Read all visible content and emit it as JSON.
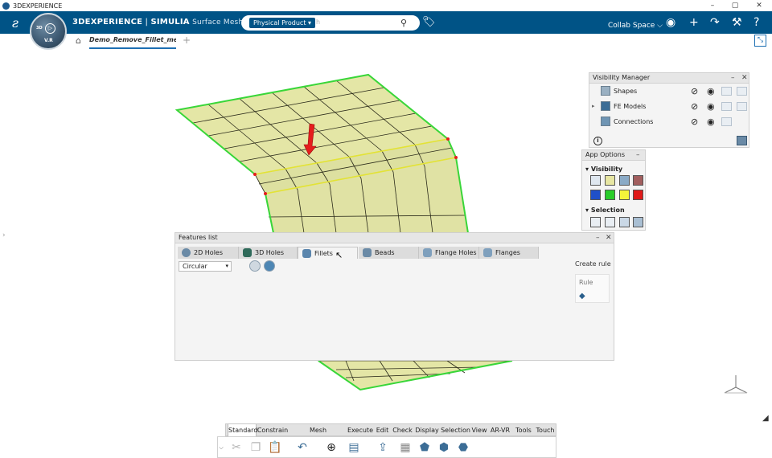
{
  "window": {
    "title": "3DEXPERIENCE",
    "controls": [
      "–",
      "▢",
      "✕"
    ]
  },
  "app": {
    "brand": "3DEXPERIENCE",
    "separator": " | ",
    "product": "SIMULIA",
    "app_name": "Surface Mesher",
    "compass_version": "V.R",
    "compass_top": "3D",
    "compass_right": "▷"
  },
  "search": {
    "scope": "Physical Product ▾",
    "placeholder": "h"
  },
  "header": {
    "collab_space": "Collab Space ⌵"
  },
  "tabs": {
    "doc_title": "Demo_Remove_Fillet_meshi",
    "add": "+"
  },
  "visibility_manager": {
    "title": "Visibility Manager",
    "rows": [
      {
        "label": "Shapes"
      },
      {
        "label": "FE Models"
      },
      {
        "label": "Connections"
      }
    ],
    "info": "i"
  },
  "app_options": {
    "title": "App Options",
    "visibility_label": "Visibility",
    "selection_label": "Selection",
    "swatches": [
      "#2050c8",
      "#29cc29",
      "#f3f33a",
      "#e01a1a"
    ]
  },
  "features_list": {
    "title": "Features list",
    "tabs": [
      {
        "label": "2D Holes"
      },
      {
        "label": "3D Holes"
      },
      {
        "label": "Fillets"
      },
      {
        "label": "Beads"
      },
      {
        "label": "Flange Holes"
      },
      {
        "label": "Flanges"
      }
    ],
    "dropdown_value": "Circular",
    "create_rule": "Create rule",
    "rule": "Rule"
  },
  "action_bar": {
    "tabs": [
      "Standard",
      "Constrain",
      "Mesh Specifications",
      "Execute",
      "Edit",
      "Check",
      "Display",
      "Selection",
      "View",
      "AR-VR",
      "Tools",
      "Touch"
    ]
  },
  "colors": {
    "topbar": "#005386",
    "mesh_fill": "#e4e6a6",
    "mesh_edge": "#39d639",
    "arrow": "#e51d1d"
  }
}
